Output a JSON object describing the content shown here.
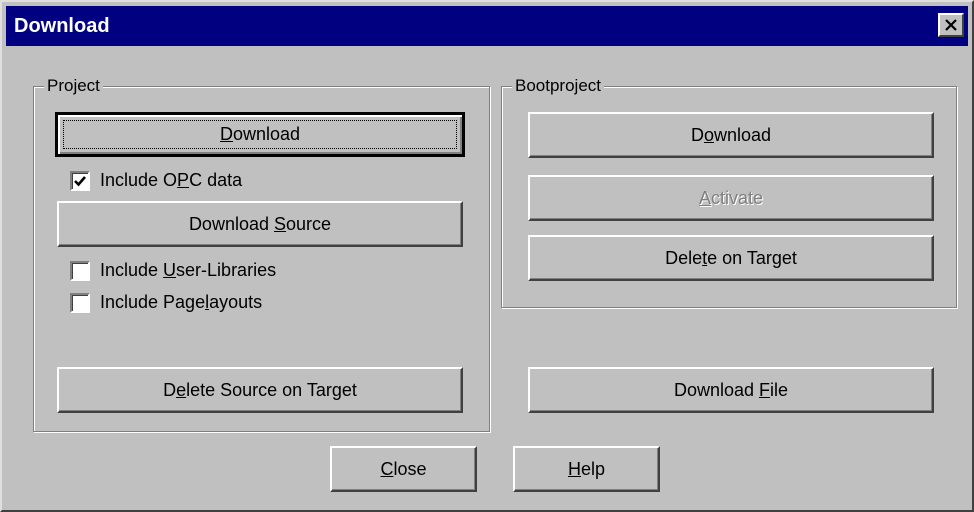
{
  "window": {
    "title": "Download",
    "close_icon": "close-x-icon"
  },
  "project": {
    "legend": "Project",
    "download": {
      "before": "",
      "key": "D",
      "after": "ownload"
    },
    "include_opc": {
      "before": "Include O",
      "key": "P",
      "after": "C data",
      "checked": true
    },
    "download_source": {
      "before": "Download ",
      "key": "S",
      "after": "ource"
    },
    "include_user_libraries": {
      "before": "Include ",
      "key": "U",
      "after": "ser-Libraries",
      "checked": false
    },
    "include_pagelayouts": {
      "before": "Include Page",
      "key": "l",
      "after": "ayouts",
      "checked": false
    },
    "delete_source": {
      "before": "D",
      "key": "e",
      "after": "lete Source on Target"
    }
  },
  "bootproject": {
    "legend": "Bootproject",
    "download": {
      "before": "D",
      "key": "o",
      "after": "wnload"
    },
    "activate": {
      "before": "",
      "key": "A",
      "after": "ctivate",
      "disabled": true
    },
    "delete_on_target": {
      "before": "Dele",
      "key": "t",
      "after": "e on Target"
    }
  },
  "download_file": {
    "before": "Download ",
    "key": "F",
    "after": "ile"
  },
  "footer": {
    "close": {
      "before": "",
      "key": "C",
      "after": "lose"
    },
    "help": {
      "before": "",
      "key": "H",
      "after": "elp"
    }
  }
}
